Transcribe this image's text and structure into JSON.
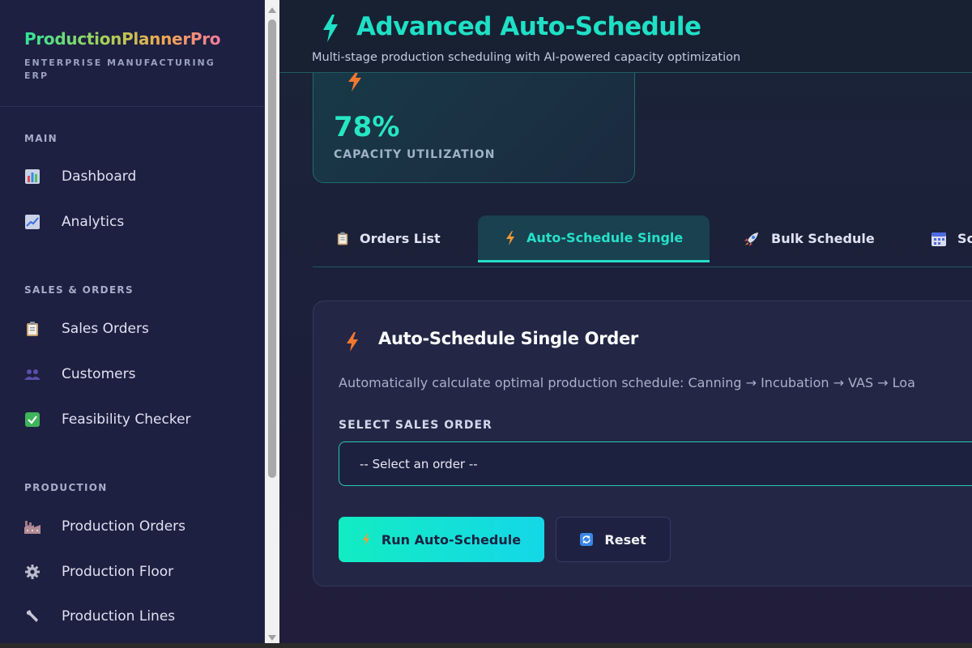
{
  "sidebar": {
    "brand": {
      "title": "ProductionPlannerPro",
      "subtitle": "ENTERPRISE MANUFACTURING ERP"
    },
    "sections": [
      {
        "title": "MAIN",
        "items": [
          {
            "label": "Dashboard",
            "icon": "bar-chart-icon"
          },
          {
            "label": "Analytics",
            "icon": "trend-chart-icon"
          }
        ]
      },
      {
        "title": "SALES & ORDERS",
        "items": [
          {
            "label": "Sales Orders",
            "icon": "clipboard-icon"
          },
          {
            "label": "Customers",
            "icon": "people-icon"
          },
          {
            "label": "Feasibility Checker",
            "icon": "check-box-icon"
          }
        ]
      },
      {
        "title": "PRODUCTION",
        "items": [
          {
            "label": "Production Orders",
            "icon": "factory-icon"
          },
          {
            "label": "Production Floor",
            "icon": "gear-icon"
          },
          {
            "label": "Production Lines",
            "icon": "wrench-icon"
          }
        ]
      }
    ]
  },
  "header": {
    "title": "Advanced Auto-Schedule",
    "subtitle": "Multi-stage production scheduling with AI-powered capacity optimization",
    "icon": "lightning-icon"
  },
  "stat_card": {
    "value": "78%",
    "label": "CAPACITY UTILIZATION",
    "icon": "lightning-icon"
  },
  "tabs": [
    {
      "label": "Orders List",
      "icon": "clipboard-icon",
      "active": false
    },
    {
      "label": "Auto-Schedule Single",
      "icon": "lightning-icon",
      "active": true
    },
    {
      "label": "Bulk Schedule",
      "icon": "rocket-icon",
      "active": false
    },
    {
      "label": "Sc",
      "icon": "calendar-icon",
      "active": false
    }
  ],
  "panel": {
    "title": "Auto-Schedule Single Order",
    "description": "Automatically calculate optimal production schedule: Canning → Incubation → VAS → Loa",
    "field_label": "SELECT SALES ORDER",
    "select_value": "-- Select an order --",
    "run_button": "Run Auto-Schedule",
    "reset_button": "Reset"
  },
  "colors": {
    "accent": "#26e0c8",
    "sidebar_bg": "#1d2040",
    "panel_bg": "#232745",
    "bolt_orange": "#f59a33"
  }
}
